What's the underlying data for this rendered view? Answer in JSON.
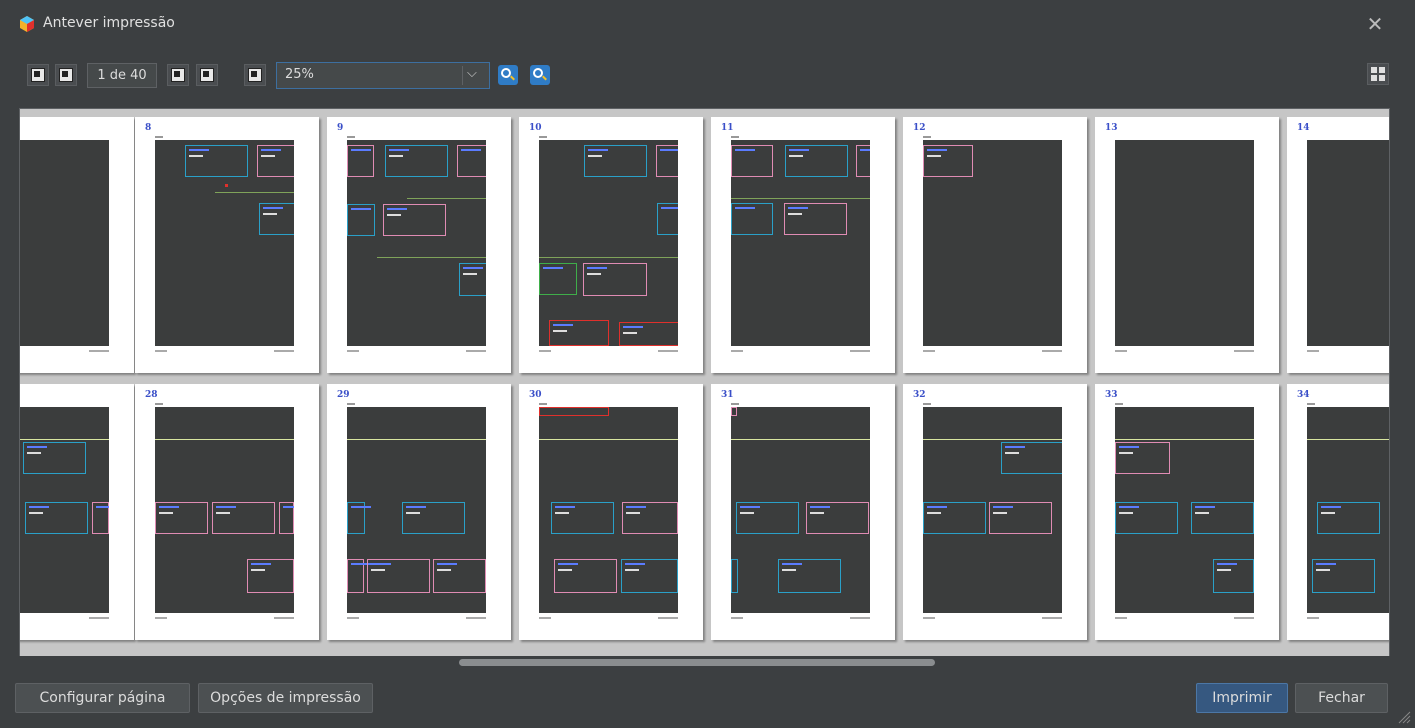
{
  "window": {
    "title": "Antever impressão",
    "close_icon": "close-icon"
  },
  "toolbar": {
    "page_indicator": "1 de 40",
    "zoom_value": "25%",
    "icons": [
      "first-page-icon",
      "previous-page-icon",
      "next-page-icon",
      "last-page-icon",
      "fit-page-icon",
      "zoom-out-icon",
      "zoom-in-icon",
      "page-layout-icon"
    ]
  },
  "preview": {
    "row1_pages": [
      "",
      "8",
      "9",
      "10",
      "11",
      "12",
      "13",
      "14"
    ],
    "row2_pages": [
      "",
      "28",
      "29",
      "30",
      "31",
      "32",
      "33",
      "34"
    ]
  },
  "buttons": {
    "page_setup": "Configurar página",
    "print_options": "Opções de impressão",
    "print": "Imprimir",
    "close": "Fechar"
  },
  "colors": {
    "primary_button": "#365880",
    "zoom_button": "#2f7cc6",
    "page_number": "#3a4fc8"
  }
}
